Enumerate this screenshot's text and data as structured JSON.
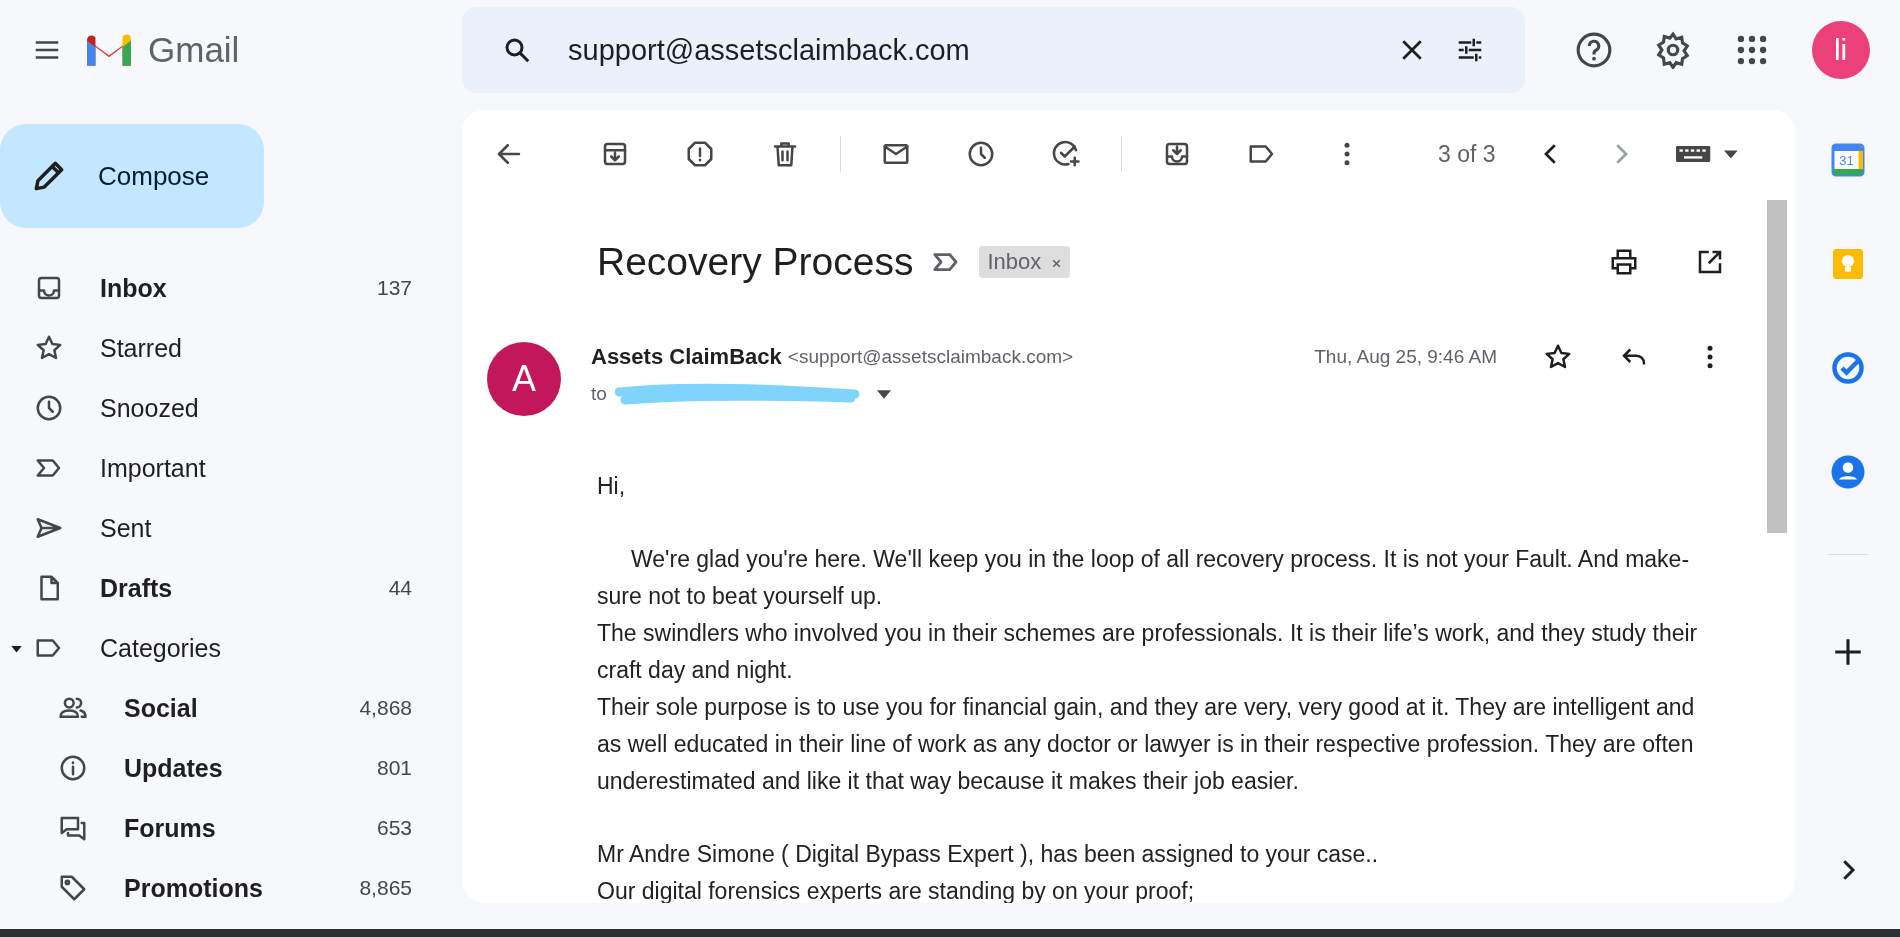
{
  "app": {
    "name": "Gmail"
  },
  "search": {
    "value": "support@assetsclaimback.com"
  },
  "account": {
    "initials": "li"
  },
  "compose": {
    "label": "Compose"
  },
  "sidebar": {
    "items": [
      {
        "label": "Inbox",
        "count": "137",
        "unread": true
      },
      {
        "label": "Starred",
        "unread": false
      },
      {
        "label": "Snoozed",
        "unread": false
      },
      {
        "label": "Important",
        "unread": false
      },
      {
        "label": "Sent",
        "unread": false
      },
      {
        "label": "Drafts",
        "count": "44",
        "unread": true
      },
      {
        "label": "Categories",
        "unread": false,
        "expanded": true,
        "children": [
          {
            "label": "Social",
            "count": "4,868",
            "unread": true
          },
          {
            "label": "Updates",
            "count": "801",
            "unread": true
          },
          {
            "label": "Forums",
            "count": "653",
            "unread": true
          },
          {
            "label": "Promotions",
            "count": "8,865",
            "unread": true
          }
        ]
      }
    ]
  },
  "toolbar": {
    "pager": "3 of 3"
  },
  "side_panel": {
    "calendar_day": "31"
  },
  "message": {
    "subject": "Recovery Process",
    "label": "Inbox",
    "avatar": "A",
    "sender_name": "Assets ClaimBack",
    "sender_email": "<support@assetsclaimback.com>",
    "date": "Thu, Aug 25, 9:46 AM",
    "recipient_prefix": "to",
    "starred": false,
    "paragraph_groups": [
      [
        {
          "text": "Hi,",
          "indented": false
        }
      ],
      [
        {
          "text": "We're glad you're here. We'll keep you in the loop of all recovery process. It is not your Fault. And make-sure not to beat yourself up.",
          "indented": true
        },
        {
          "text": "The swindlers who involved you in their schemes are professionals. It is their life’s work, and they study their craft day and night.",
          "indented": false
        },
        {
          "text": "Their sole purpose is to use you for financial gain, and they are very, very good at it. They are intelligent and as well educated in their line of work as any doctor or lawyer is in their respective profession. They are often underestimated and like it that way because it makes their job easier.",
          "indented": false
        }
      ],
      [
        {
          "text": "Mr Andre Simone ( Digital Bypass Expert ), has been assigned to your case..",
          "indented": false
        },
        {
          "text": "Our digital forensics experts are standing by on your proof;",
          "indented": false
        }
      ]
    ]
  }
}
